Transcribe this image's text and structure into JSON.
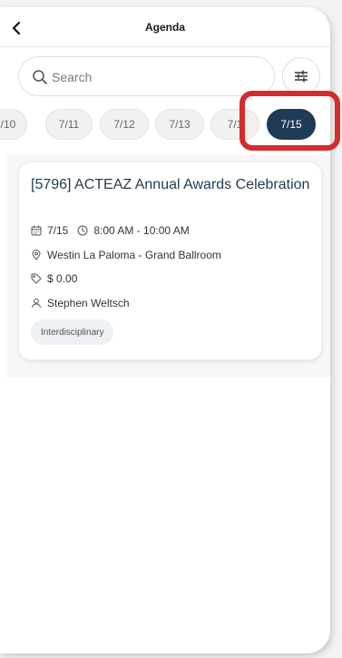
{
  "header": {
    "title": "Agenda"
  },
  "search": {
    "placeholder": "Search"
  },
  "dates": [
    {
      "label": "/10",
      "active": false
    },
    {
      "label": "7/11",
      "active": false
    },
    {
      "label": "7/12",
      "active": false
    },
    {
      "label": "7/13",
      "active": false
    },
    {
      "label": "7/1",
      "active": false
    },
    {
      "label": "7/15",
      "active": true
    }
  ],
  "event": {
    "title": "[5796] ACTEAZ Annual Awards Celebration",
    "date": "7/15",
    "time": "8:00 AM - 10:00 AM",
    "location": "Westin La Paloma - Grand Ballroom",
    "price": "$ 0.00",
    "speaker": "Stephen Weltsch",
    "tag": "Interdisciplinary"
  },
  "colors": {
    "active_chip": "#1f3b55",
    "highlight": "#d52b2b",
    "title_text": "#1f3b55"
  }
}
